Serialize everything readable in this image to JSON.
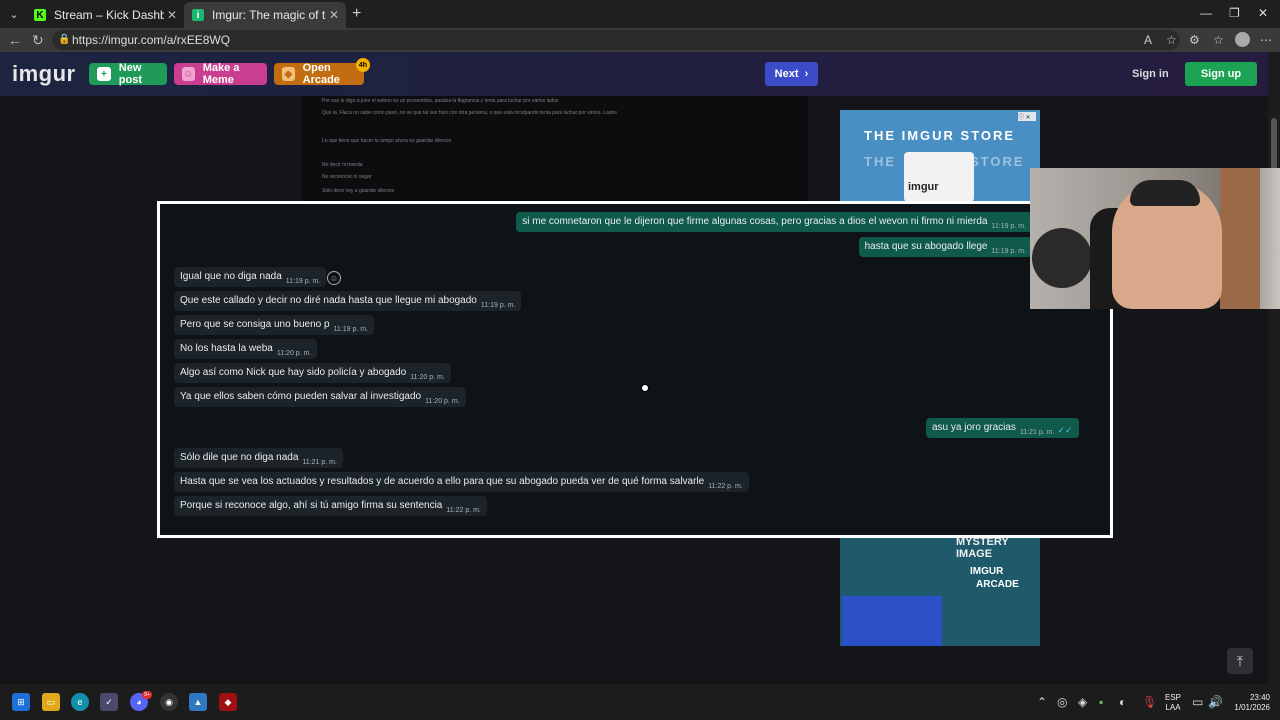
{
  "browser": {
    "tabs": [
      {
        "title": "Stream – Kick Dashboard",
        "active": false,
        "favicon": "kick-icon",
        "color": "#53fc18"
      },
      {
        "title": "Imgur: The magic of the Internet",
        "active": true,
        "favicon": "imgur-icon",
        "color": "#1bb76e"
      }
    ],
    "url": "https://imgur.com/a/rxEE8WQ"
  },
  "imgur": {
    "logo": "imgur",
    "new_post": "New post",
    "make_meme": "Make a Meme",
    "open_arcade": "Open Arcade",
    "arcade_badge": "4h",
    "next": "Next",
    "sign_in": "Sign in",
    "sign_up": "Sign up"
  },
  "background_chat": [
    "Por eso le digo a jono el webon es un prosentoba, pasaba la flagrancia y tenia para luchar por varios lados",
    "Que la. Flaca no sabe como pasó, no se que tal vez hizo con otra persona, o que está inculpando tenia para luchar por varios. Lados",
    "Lo que tiene que hacer tu amigo ahora es guardar silencio",
    "No decir ni mierda",
    "No reconocer ni negar",
    "Sólo decir voy a guardar silencio"
  ],
  "ads": {
    "store_title": "THE IMGUR STORE",
    "mug_text": "imgur",
    "arcade_title": "MYSTERY IMAGE",
    "arcade_line1": "IMGUR",
    "arcade_line2": "ARCADE"
  },
  "chat": {
    "messages": [
      {
        "dir": "out",
        "text": "si me comnetaron que le dijeron que firme algunas cosas, pero gracias a dios el wevon ni firmo ni mierda",
        "time": "11:19 p. m."
      },
      {
        "dir": "out",
        "text": "hasta que su abogado llege",
        "time": "11:19 p. m."
      },
      {
        "dir": "in",
        "text": "Igual que no diga nada",
        "time": "11:19 p. m."
      },
      {
        "dir": "in",
        "text": "Que este callado y decir no diré nada hasta que llegue mi abogado",
        "time": "11:19 p. m."
      },
      {
        "dir": "in",
        "text": "Pero que se consiga uno bueno p",
        "time": "11:19 p. m."
      },
      {
        "dir": "in",
        "text": "No los hasta la weba",
        "time": "11:20 p. m."
      },
      {
        "dir": "in",
        "text": "Algo así como Nick que hay sido policía y abogado",
        "time": "11:20 p. m."
      },
      {
        "dir": "in",
        "text": "Ya que ellos saben cómo pueden salvar al investigado",
        "time": "11:20 p. m."
      },
      {
        "dir": "out",
        "text": "asu ya joro gracias",
        "time": "11:21 p. m.",
        "ticks": "✓✓"
      },
      {
        "dir": "in",
        "text": "Sólo dile que no diga nada",
        "time": "11:21 p. m."
      },
      {
        "dir": "in",
        "text": "Hasta que se vea los actuados y resultados y de acuerdo a ello para que su abogado pueda ver de qué forma salvarle",
        "time": "11:22 p. m."
      },
      {
        "dir": "in",
        "text": "Porque si reconoce algo, ahí si tú amigo firma su sentencia",
        "time": "11:22 p. m."
      }
    ]
  },
  "taskbar": {
    "lang_line1": "ESP",
    "lang_line2": "LAA",
    "time": "23:40",
    "date": "1/01/2026",
    "discord_badge": "9+"
  }
}
